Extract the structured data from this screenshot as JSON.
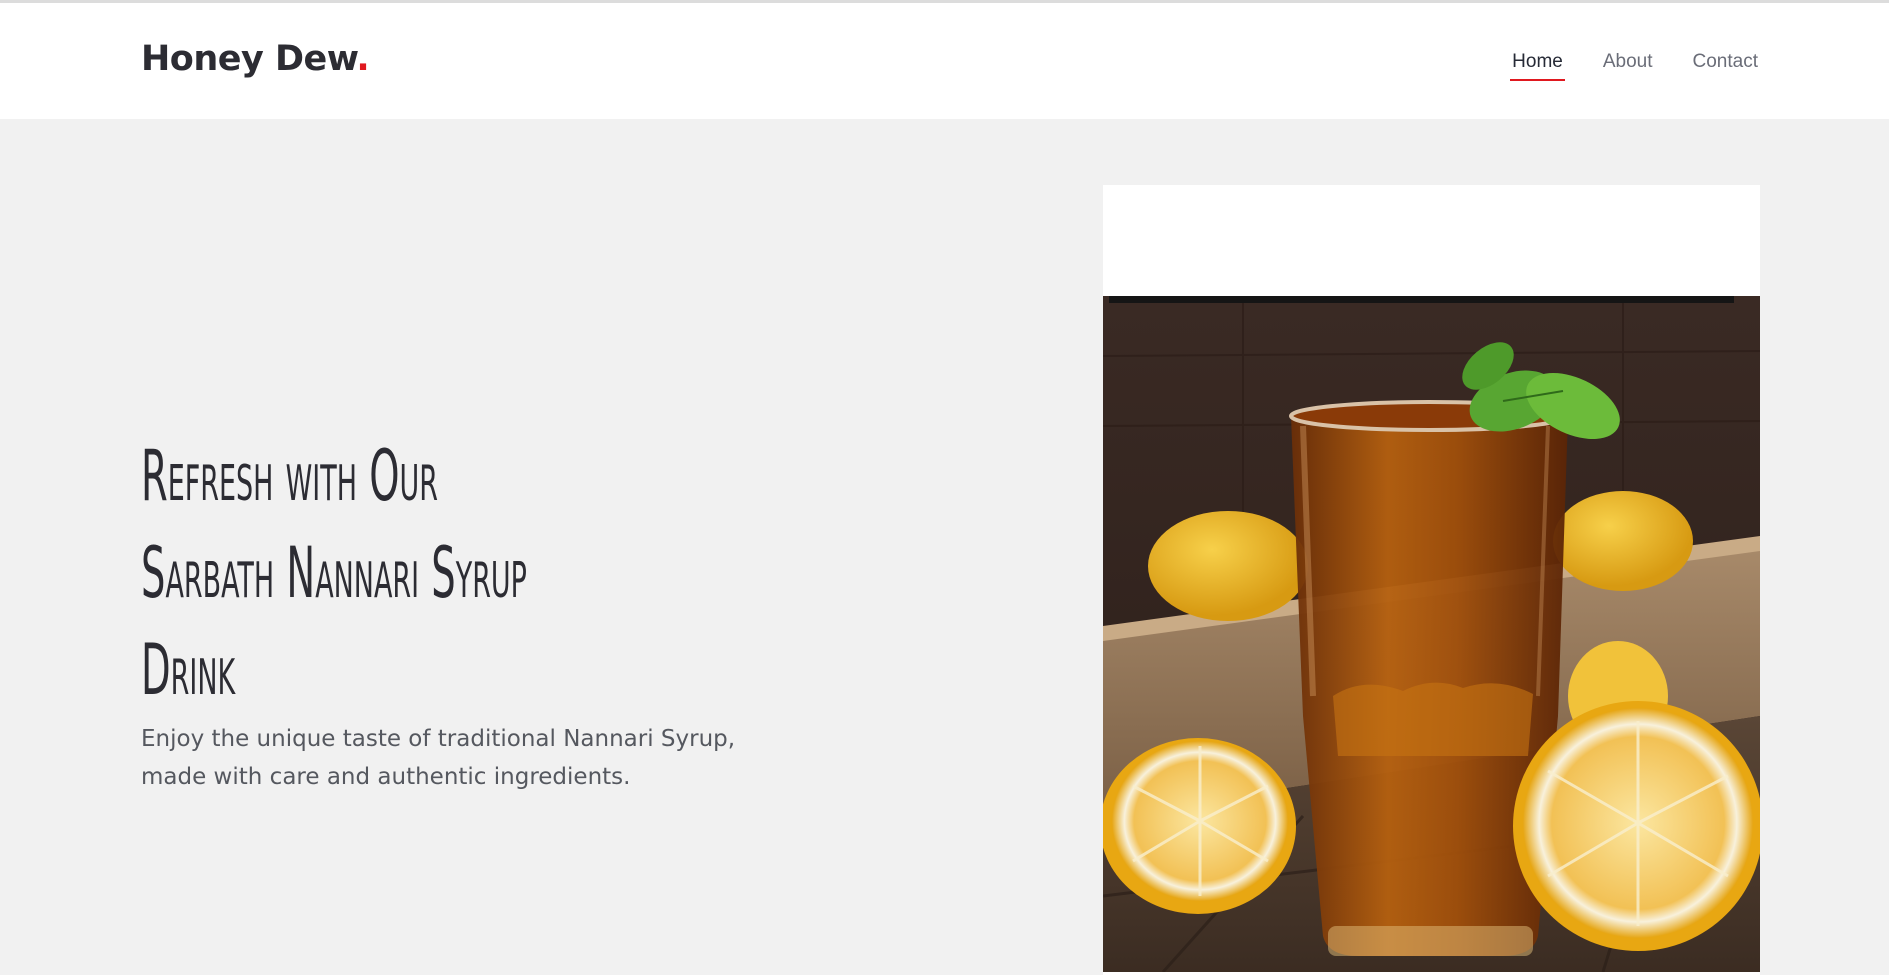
{
  "header": {
    "brand": "Honey Dew",
    "brand_dot": ".",
    "nav": [
      {
        "label": "Home",
        "active": true
      },
      {
        "label": "About",
        "active": false
      },
      {
        "label": "Contact",
        "active": false
      }
    ]
  },
  "hero": {
    "title_lines": [
      "Refresh with Our",
      "Sarbath Nannari Syrup",
      "Drink"
    ],
    "subtitle": "Enjoy the unique taste of traditional Nannari Syrup, made with care and authentic ingredients."
  },
  "colors": {
    "accent": "#e0181f",
    "background": "#f1f1f1",
    "text_dark": "#2c2c33"
  },
  "image": {
    "icon": "nannari-drink-photo"
  }
}
